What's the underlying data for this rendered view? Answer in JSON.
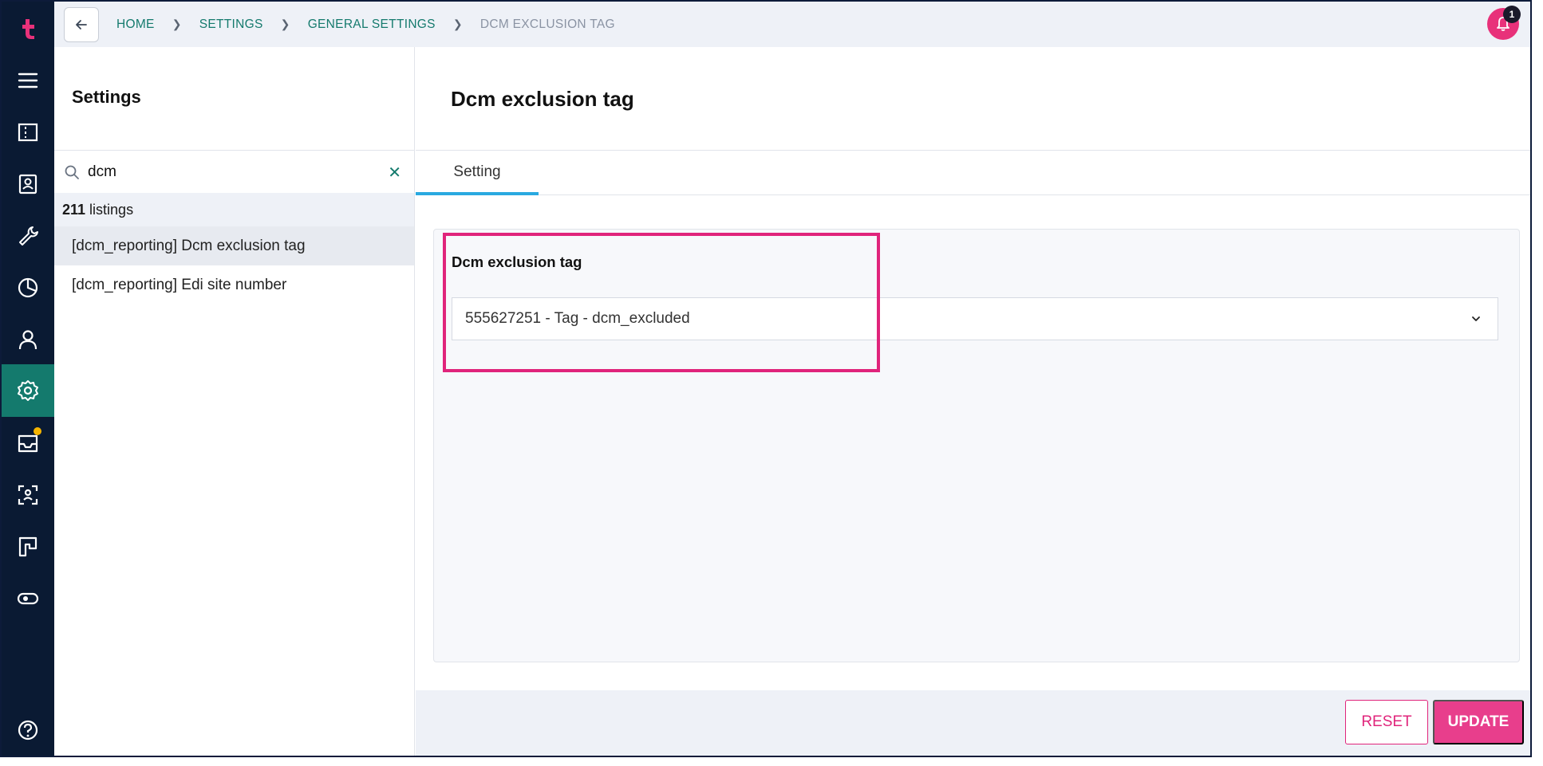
{
  "nav": {
    "icons": [
      "logo-icon",
      "menu-icon",
      "ticket-icon",
      "contact-card-icon",
      "wrench-icon",
      "pie-chart-icon",
      "user-icon",
      "gear-icon",
      "inbox-icon",
      "face-scan-icon",
      "board-icon",
      "toggle-icon",
      "help-icon"
    ],
    "active": "gear-icon"
  },
  "breadcrumb": {
    "home": "HOME",
    "settings": "SETTINGS",
    "general": "GENERAL SETTINGS",
    "current": "DCM EXCLUSION TAG"
  },
  "notifications": {
    "count": "1"
  },
  "settings_panel": {
    "title": "Settings",
    "search_value": "dcm",
    "count": "211",
    "count_label": "listings",
    "items": [
      {
        "label": "[dcm_reporting] Dcm exclusion tag"
      },
      {
        "label": "[dcm_reporting] Edi site number"
      }
    ]
  },
  "main": {
    "title": "Dcm exclusion tag",
    "tab": "Setting",
    "field_label": "Dcm exclusion tag",
    "field_value": "555627251 - Tag - dcm_excluded"
  },
  "footer": {
    "reset": "RESET",
    "update": "UPDATE"
  },
  "colors": {
    "rail": "#0a1a33",
    "accent": "#147a6d",
    "brand": "#e83e8c",
    "highlight": "#e0247b"
  }
}
